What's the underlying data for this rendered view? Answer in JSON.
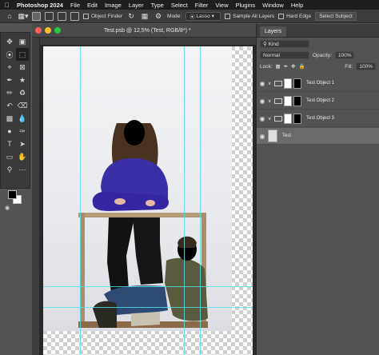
{
  "menubar": {
    "apple": "",
    "app": "Photoshop 2024",
    "items": [
      "File",
      "Edit",
      "Image",
      "Layer",
      "Type",
      "Select",
      "Filter",
      "View",
      "Plugins",
      "Window",
      "Help"
    ]
  },
  "options": {
    "object_finder": "Object Finder",
    "mode_label": "Mode:",
    "mode_value": "Lasso",
    "sample_all_layers": "Sample All Layers",
    "hard_edge": "Hard Edge",
    "select_subject": "Select Subject"
  },
  "document": {
    "title": "Test.psb @ 12,5% (Test, RGB/8*) *"
  },
  "layers_panel": {
    "tab": "Layers",
    "filter": "Kind",
    "blend_mode": "Normal",
    "opacity_label": "Opacity:",
    "opacity_value": "100%",
    "lock_label": "Lock:",
    "fill_label": "Fill:",
    "fill_value": "100%",
    "layers": [
      {
        "name": "Test Object 1"
      },
      {
        "name": "Test Object 2"
      },
      {
        "name": "Test Object 3"
      },
      {
        "name": "Test"
      }
    ]
  },
  "colors": {
    "guide": "#54e0e6",
    "sweater": "#3b2fa8",
    "jacket": "#5a5a3e"
  }
}
